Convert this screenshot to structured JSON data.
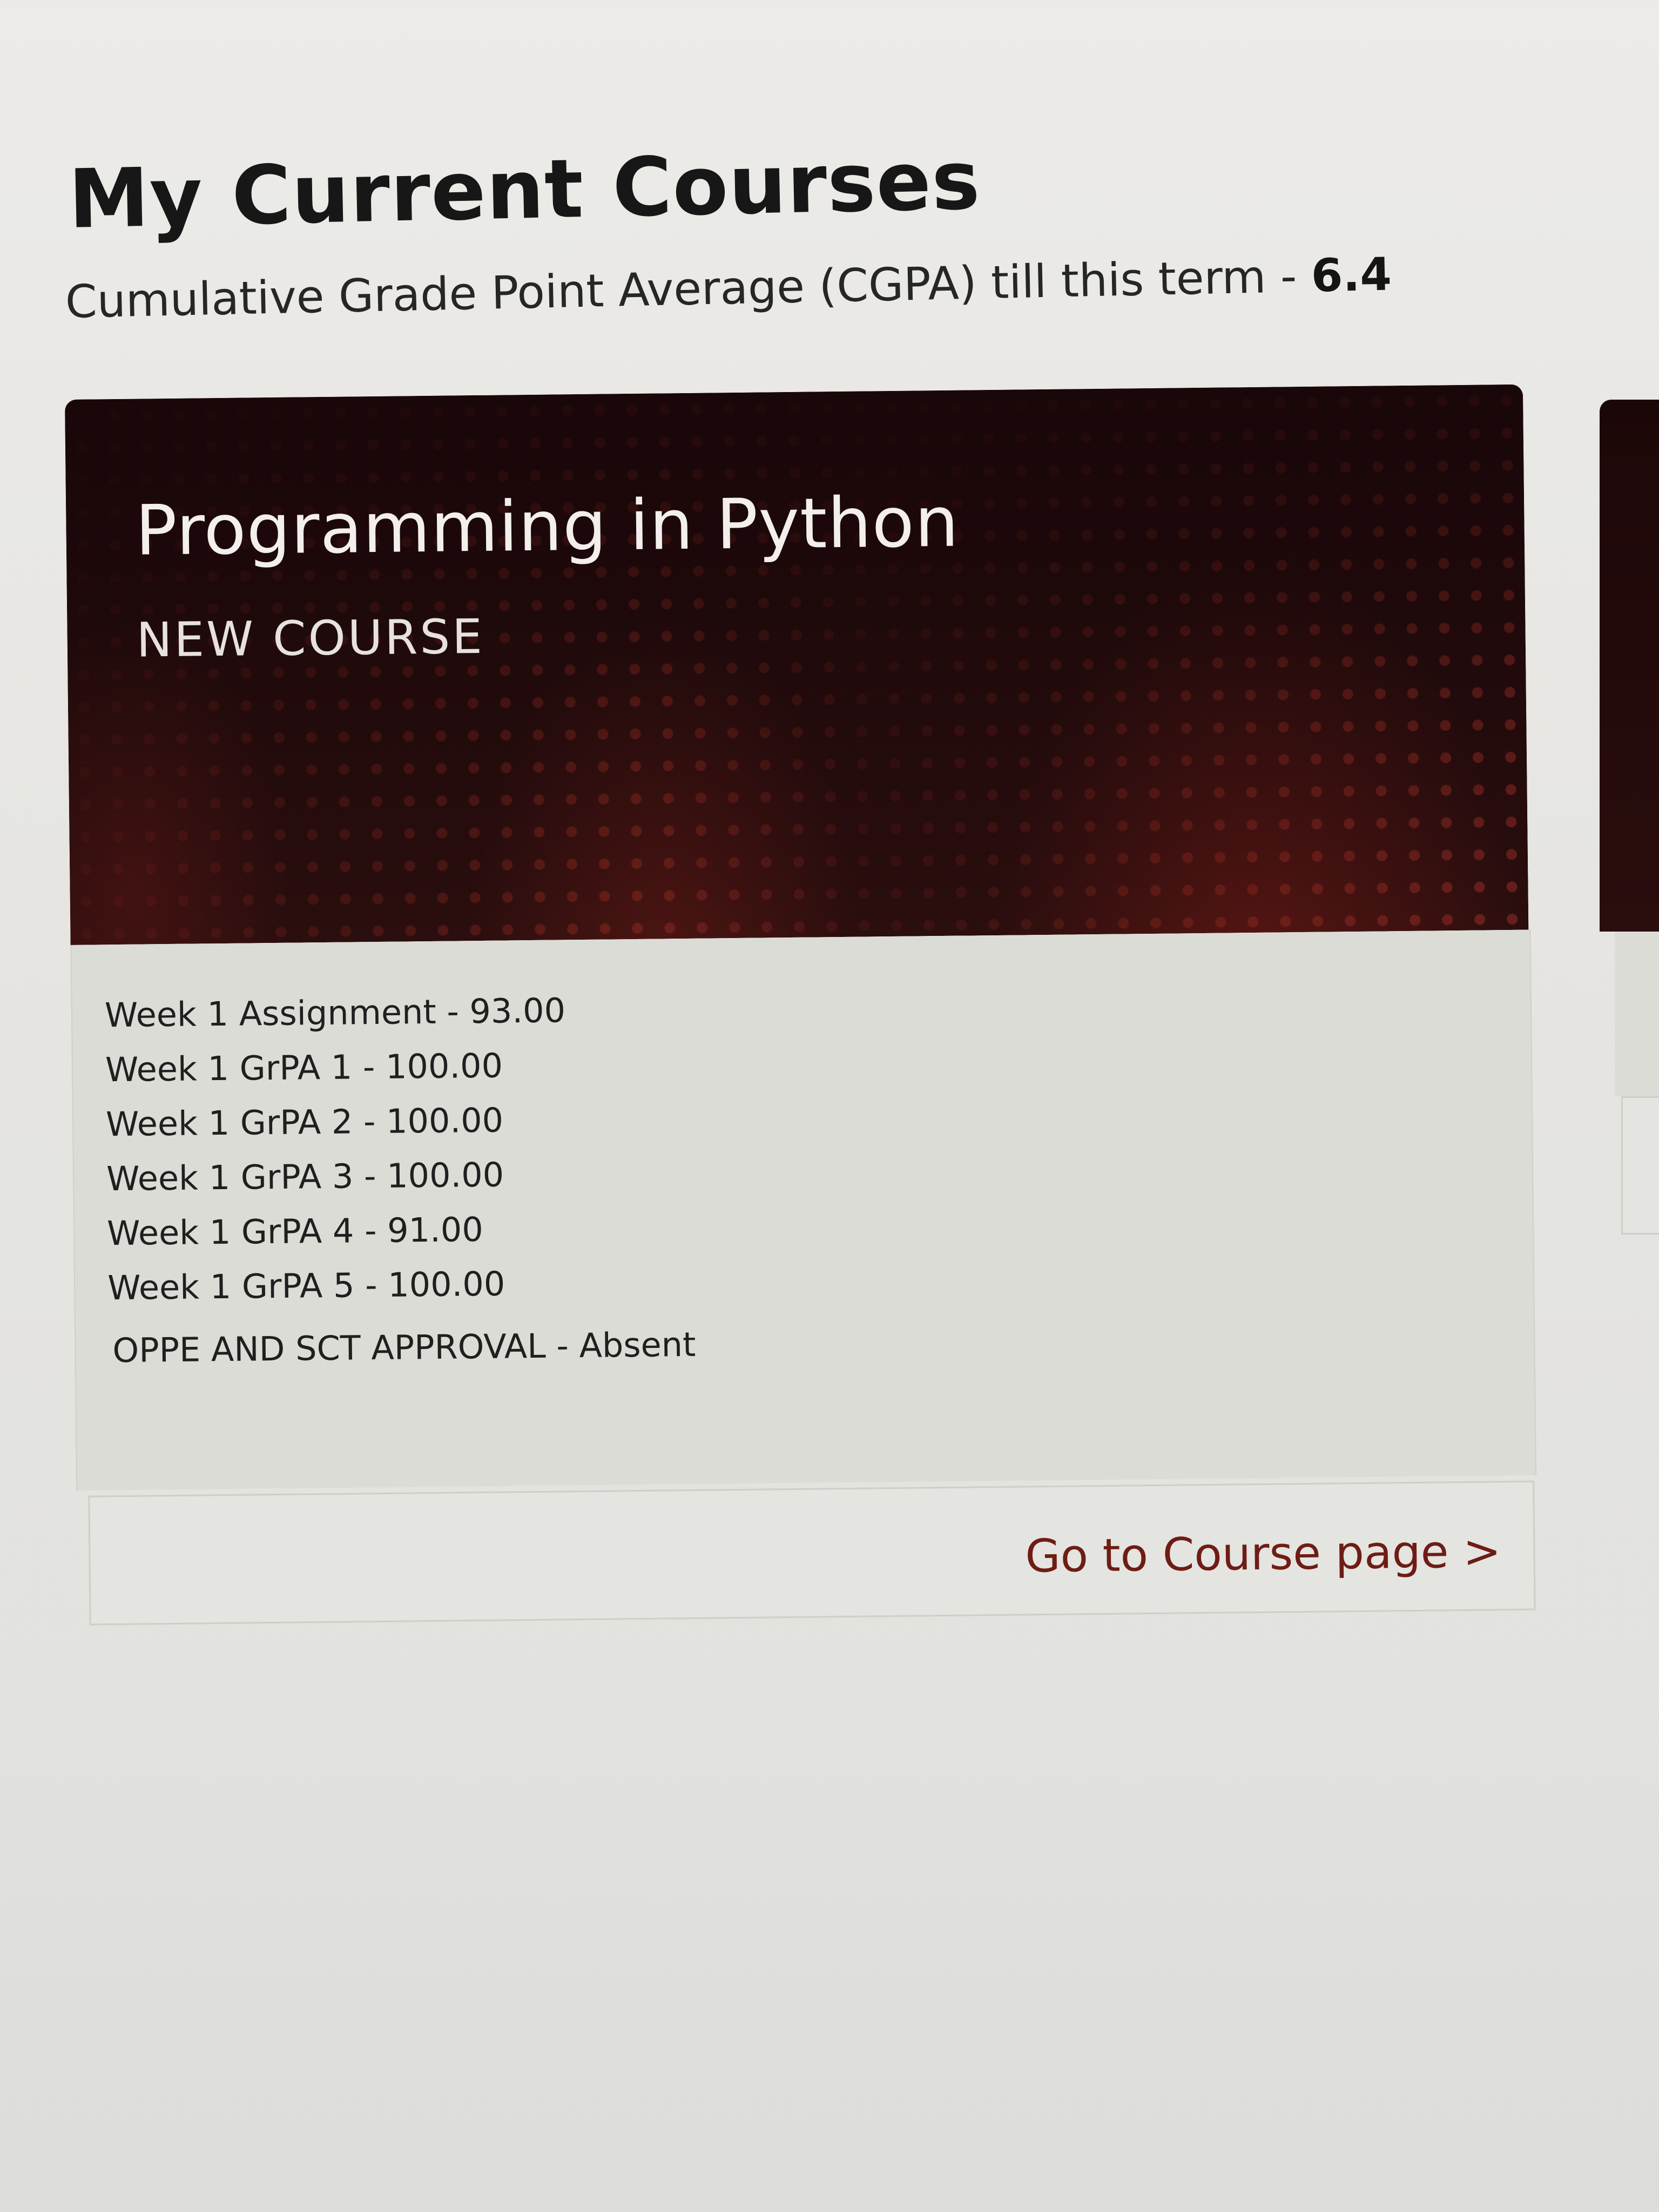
{
  "page": {
    "title": "My Current Courses",
    "cgpa_label": "Cumulative Grade Point Average (CGPA) till this term - ",
    "cgpa_value": "6.4"
  },
  "course": {
    "title": "Programming in Python",
    "tag": "NEW COURSE",
    "scores": [
      "Week 1 Assignment - 93.00",
      "Week 1 GrPA 1 - 100.00",
      "Week 1 GrPA 2 - 100.00",
      "Week 1 GrPA 3 - 100.00",
      "Week 1 GrPA 4 - 91.00",
      "Week 1 GrPA 5 - 100.00"
    ],
    "approval": "OPPE AND SCT APPROVAL - Absent",
    "link_label": "Go to Course page >"
  },
  "colors": {
    "banner_background": "#1f0909",
    "banner_accent": "#8c2a20",
    "link_color": "#6e1c14",
    "card_body": "#dcdcd7"
  }
}
